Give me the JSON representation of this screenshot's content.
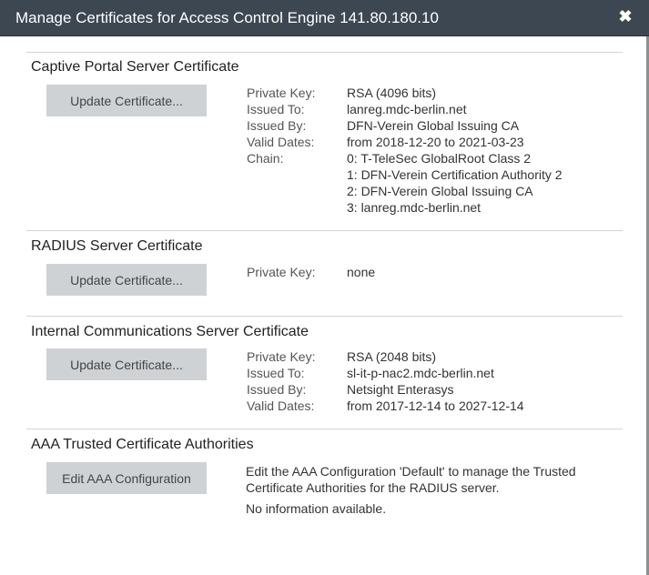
{
  "dialog": {
    "title": "Manage Certificates for Access Control Engine 141.80.180.10",
    "close_glyph": "✖"
  },
  "sections": [
    {
      "title": "Captive Portal Server Certificate",
      "button_label": "Update Certificate...",
      "fields": [
        {
          "label": "Private Key:",
          "value": "RSA (4096 bits)"
        },
        {
          "label": "Issued To:",
          "value": "lanreg.mdc-berlin.net"
        },
        {
          "label": "Issued By:",
          "value": "DFN-Verein Global Issuing CA"
        },
        {
          "label": "Valid Dates:",
          "value": "from 2018-12-20 to 2021-03-23"
        },
        {
          "label": "Chain:",
          "value": "0: T-TeleSec GlobalRoot Class 2"
        }
      ],
      "chain_extra": [
        "1: DFN-Verein Certification Authority 2",
        "2: DFN-Verein Global Issuing CA",
        "3: lanreg.mdc-berlin.net"
      ]
    },
    {
      "title": "RADIUS Server Certificate",
      "button_label": "Update Certificate...",
      "fields": [
        {
          "label": "Private Key:",
          "value": "none"
        }
      ]
    },
    {
      "title": "Internal Communications Server Certificate",
      "button_label": "Update Certificate...",
      "fields": [
        {
          "label": "Private Key:",
          "value": "RSA (2048 bits)"
        },
        {
          "label": "Issued To:",
          "value": "sl-it-p-nac2.mdc-berlin.net"
        },
        {
          "label": "Issued By:",
          "value": "Netsight Enterasys"
        },
        {
          "label": "Valid Dates:",
          "value": "from 2017-12-14 to 2027-12-14"
        }
      ]
    },
    {
      "title": "AAA Trusted Certificate Authorities",
      "button_label": "Edit AAA Configuration",
      "description": "Edit the AAA Configuration 'Default' to manage the Trusted Certificate Authorities for the RADIUS server.",
      "no_info": "No information available."
    }
  ]
}
